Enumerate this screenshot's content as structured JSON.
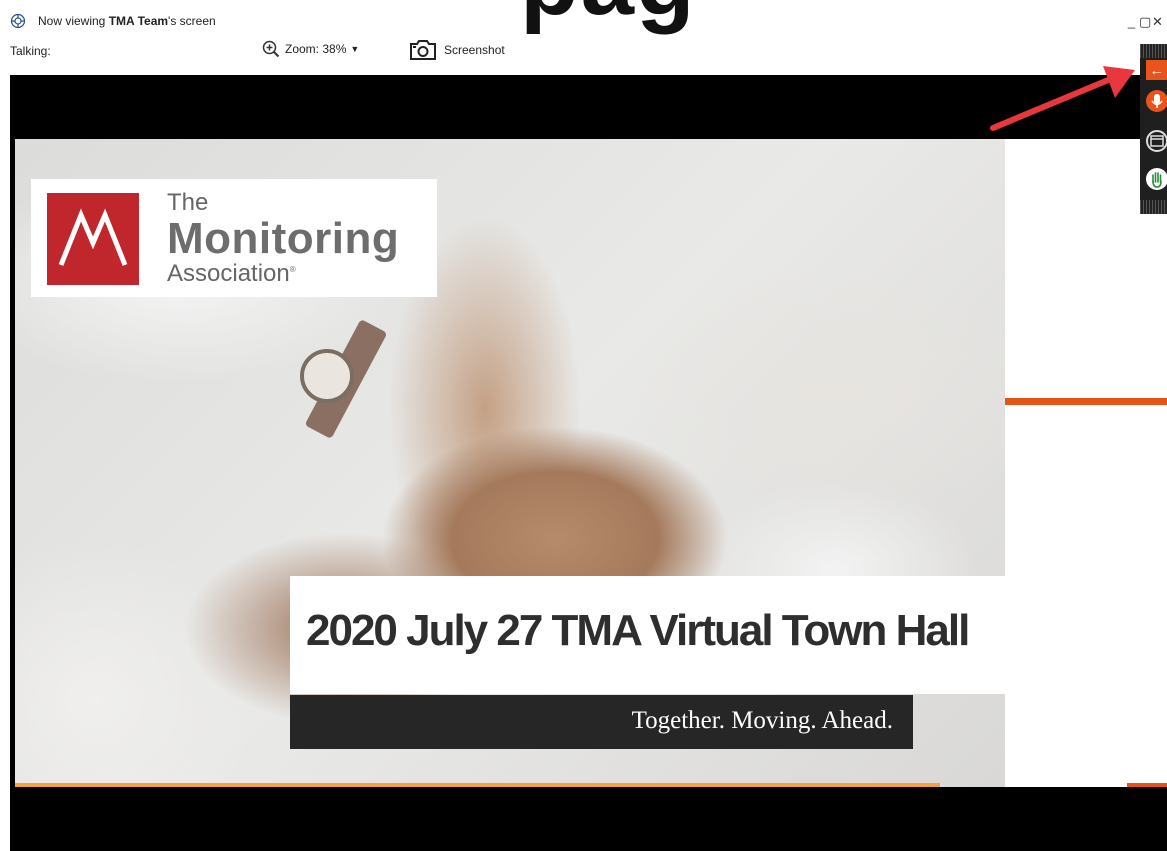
{
  "window": {
    "viewing_prefix": "Now viewing ",
    "viewing_name": "TMA Team",
    "viewing_suffix": "'s screen",
    "talking_label": "Talking:",
    "zoom_label": "Zoom: 38%",
    "screenshot_label": "Screenshot",
    "controls": {
      "minimize": "_",
      "maximize": "▢",
      "close": "✕"
    }
  },
  "overflow_text": "pag",
  "slide": {
    "logo": {
      "the": "The",
      "monitoring": "Monitoring",
      "association": "Association",
      "registered": "®"
    },
    "title": "2020 July 27 TMA Virtual Town Hall",
    "tagline": "Together. Moving. Ahead."
  },
  "floating_toolbar": {
    "icons": [
      "back-arrow-icon",
      "microphone-icon",
      "window-icon",
      "raise-hand-icon"
    ]
  },
  "colors": {
    "accent_orange": "#e2541a",
    "logo_red": "#c0272d",
    "highlight_arrow": "#e8383d"
  }
}
